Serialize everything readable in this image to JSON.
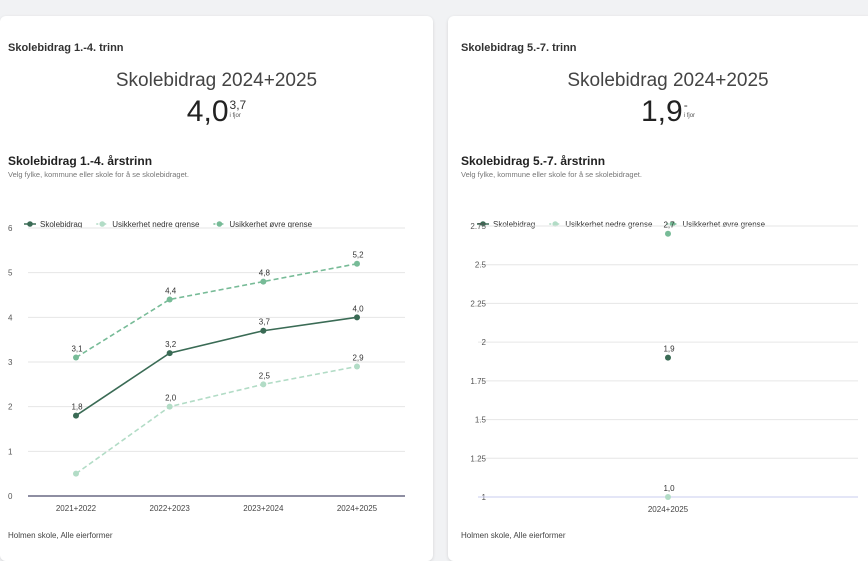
{
  "left_card": {
    "card_title": "Skolebidrag 1.-4. trinn",
    "big_title": "Skolebidrag 2024+2025",
    "big_value": "4,0",
    "prev_value": "3,7",
    "prev_label": "i fjor",
    "sub_title": "Skolebidrag 1.-4. årstrinn",
    "sub_desc": "Velg fylke, kommune eller skole for å se skolebidraget.",
    "footer": "Holmen skole, Alle eierformer"
  },
  "right_card": {
    "card_title": "Skolebidrag 5.-7. trinn",
    "big_title": "Skolebidrag 2024+2025",
    "big_value": "1,9",
    "prev_value": "-",
    "prev_label": "i fjor",
    "sub_title": "Skolebidrag 5.-7. årstrinn",
    "sub_desc": "Velg fylke, kommune eller skole for å se skolebidraget.",
    "footer": "Holmen skole, Alle eierformer"
  },
  "colors": {
    "skolebidrag": "#3a6b55",
    "nedre": "#b2dcc6",
    "ovre": "#77bb97",
    "grid": "#e6e6e6",
    "axis_dark": "#4a4a6a",
    "axis_light": "#c9ccef"
  },
  "chart_data": [
    {
      "type": "line",
      "categories": [
        "2021+2022",
        "2022+2023",
        "2023+2024",
        "2024+2025"
      ],
      "series": [
        {
          "name": "Skolebidrag",
          "values": [
            1.8,
            3.2,
            3.7,
            4.0
          ],
          "labels": [
            "1,8",
            "3,2",
            "3,7",
            "4,0"
          ],
          "style": "solid"
        },
        {
          "name": "Usikkerhet nedre grense",
          "values": [
            0.5,
            2.0,
            2.5,
            2.9
          ],
          "labels": [
            "",
            "2,0",
            "2,5",
            "2,9"
          ],
          "style": "dashed"
        },
        {
          "name": "Usikkerhet øvre grense",
          "values": [
            3.1,
            4.4,
            4.8,
            5.2
          ],
          "labels": [
            "3,1",
            "4,4",
            "4,8",
            "5,2"
          ],
          "style": "dashed"
        }
      ],
      "yticks": [
        "0",
        "1",
        "2",
        "3",
        "4",
        "5",
        "6"
      ],
      "ylim": [
        0,
        6
      ],
      "grid": true,
      "legend": "top-left"
    },
    {
      "type": "scatter",
      "categories": [
        "2024+2025"
      ],
      "series": [
        {
          "name": "Skolebidrag",
          "values": [
            1.9
          ],
          "labels": [
            "1,9"
          ]
        },
        {
          "name": "Usikkerhet nedre grense",
          "values": [
            1.0
          ],
          "labels": [
            "1,0"
          ]
        },
        {
          "name": "Usikkerhet øvre grense",
          "values": [
            2.7
          ],
          "labels": [
            "2,7"
          ]
        }
      ],
      "yticks": [
        "1",
        "1.25",
        "1.5",
        "1.75",
        "2",
        "2.25",
        "2.5",
        "2.75"
      ],
      "ylim": [
        1,
        2.75
      ],
      "grid": true,
      "legend": "top-left"
    }
  ]
}
